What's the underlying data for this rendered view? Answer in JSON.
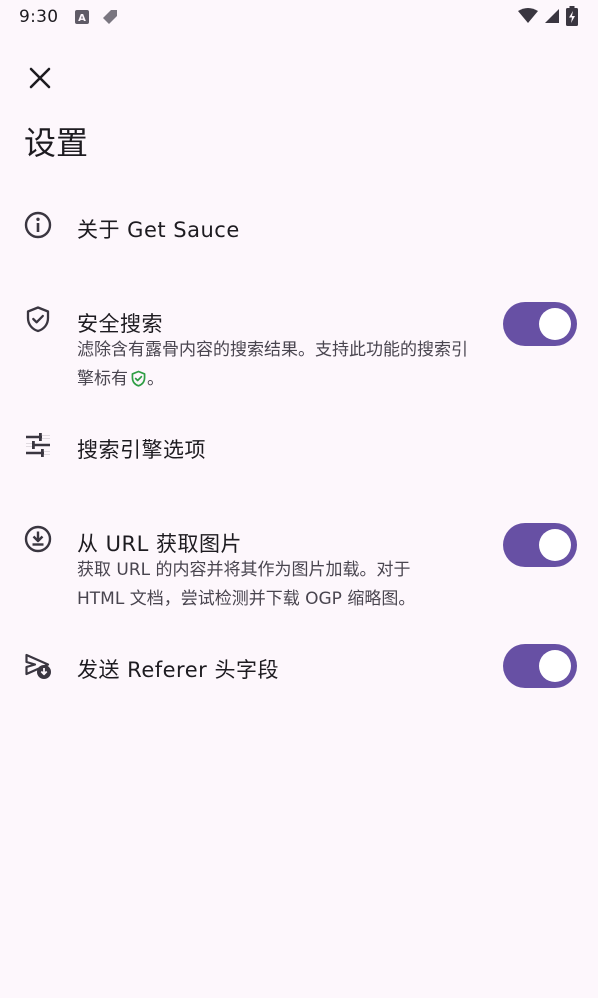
{
  "status_bar": {
    "time": "9:30"
  },
  "header": {
    "close_icon": "close-icon",
    "title": "设置"
  },
  "settings": {
    "about": {
      "icon": "info-icon",
      "title": "关于 Get Sauce"
    },
    "safe_search": {
      "icon": "shield-check-icon",
      "title": "安全搜索",
      "description_before": "滤除含有露骨内容的搜索结果。支持此功能的搜索引擎标有",
      "description_after": "。",
      "enabled": true
    },
    "search_engine_options": {
      "icon": "tune-icon",
      "title": "搜索引擎选项"
    },
    "fetch_from_url": {
      "icon": "download-circle-icon",
      "title": "从 URL 获取图片",
      "description": "获取 URL 的内容并将其作为图片加载。对于 HTML 文档，尝试检测并下载 OGP 缩略图。",
      "enabled": true
    },
    "send_referer": {
      "icon": "send-download-icon",
      "title": "发送 Referer 头字段",
      "enabled": true
    }
  },
  "colors": {
    "background": "#fdf7fc",
    "toggle_on": "#6750a4",
    "safe_badge": "#2e9e44"
  }
}
